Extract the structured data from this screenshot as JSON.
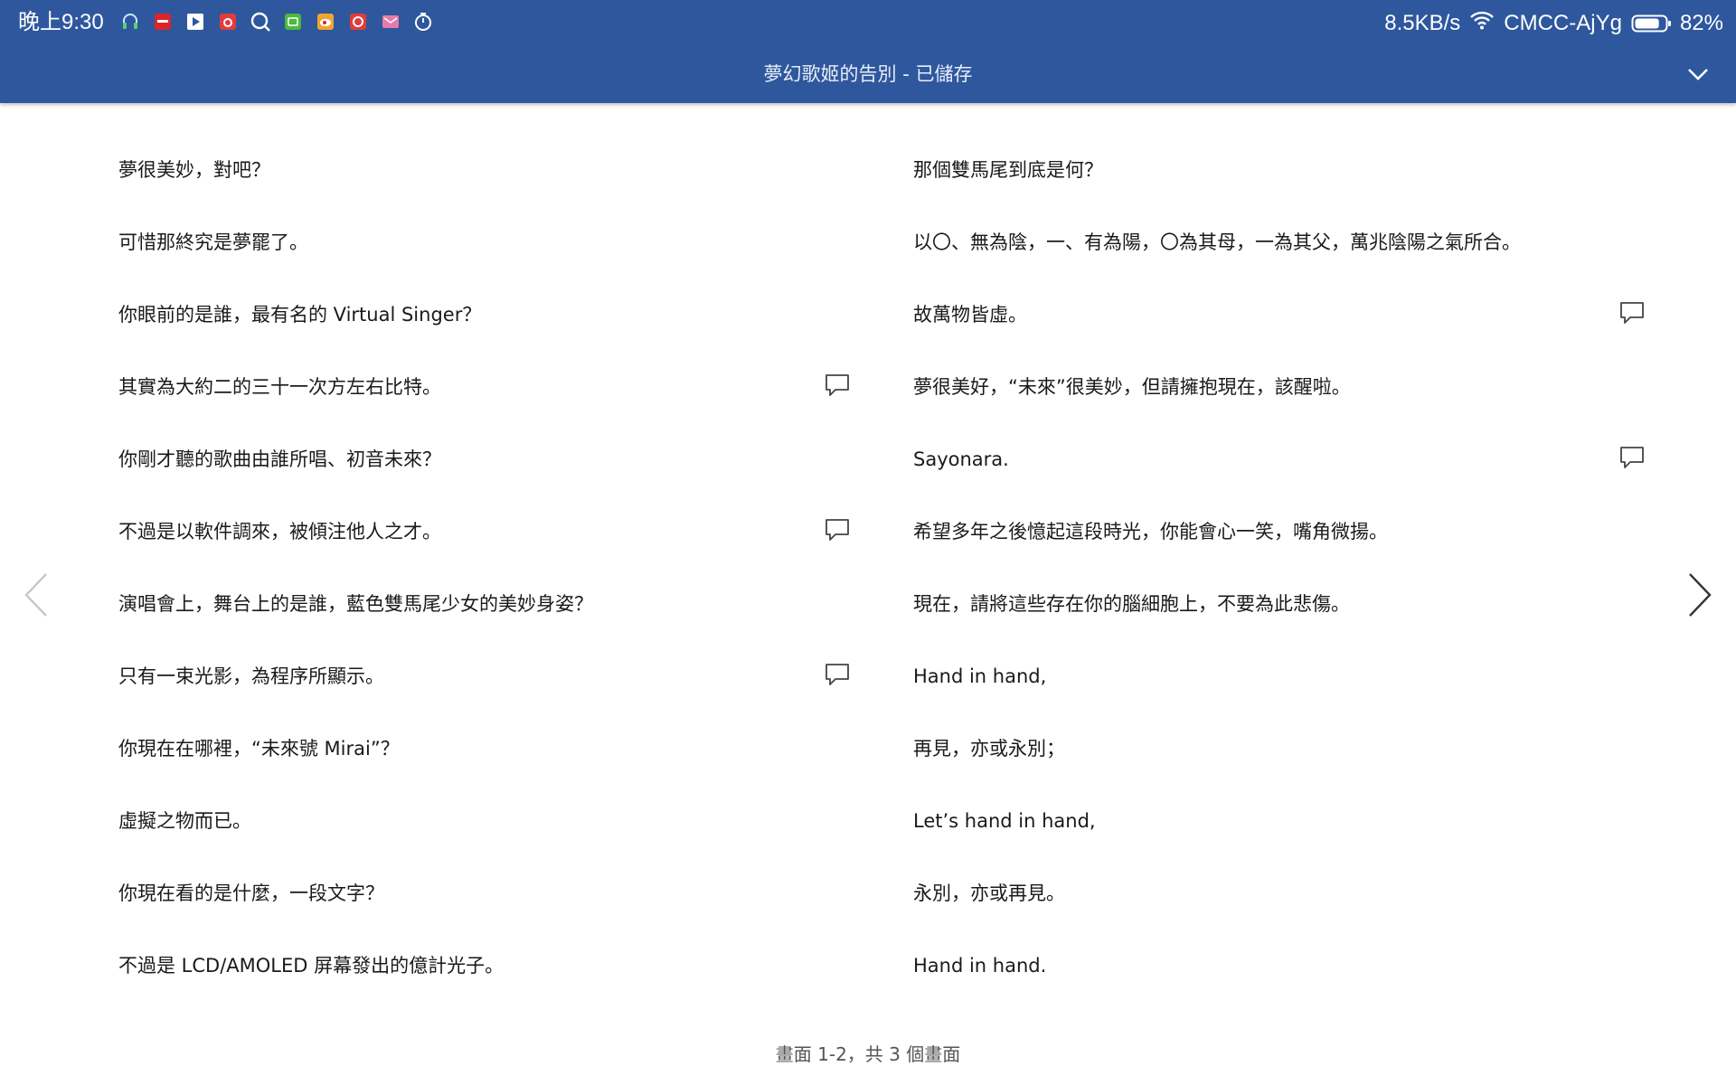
{
  "status_bar": {
    "time": "晚上9:30",
    "notification_icons": [
      "headset-icon",
      "news-app-icon",
      "video-play-icon",
      "bug-app-icon",
      "search-app-icon",
      "iqiyi-app-icon",
      "weibo-app-icon",
      "netease-music-icon",
      "mail-app-icon",
      "timer-icon"
    ],
    "network_speed": "8.5KB/s",
    "wifi_name": "CMCC-AjYg",
    "battery_percent": "82%",
    "battery_level": 0.82
  },
  "header": {
    "title": "夢幻歌姬的告別 - 已儲存",
    "accent_color": "#2e579d"
  },
  "document": {
    "left_column": [
      {
        "text": "夢很美妙，對吧？",
        "has_comment": false
      },
      {
        "text": "可惜那終究是夢罷了。",
        "has_comment": false
      },
      {
        "text": "你眼前的是誰，最有名的 Virtual Singer？",
        "has_comment": false
      },
      {
        "text": "其實為大約二的三十一次方左右比特。",
        "has_comment": true
      },
      {
        "text": "你剛才聽的歌曲由誰所唱、初音未來？",
        "has_comment": false
      },
      {
        "text": "不過是以軟件調來，被傾注他人之才。",
        "has_comment": true
      },
      {
        "text": "演唱會上，舞台上的是誰，藍色雙馬尾少女的美妙身姿？",
        "has_comment": false
      },
      {
        "text": "只有一束光影，為程序所顯示。",
        "has_comment": true
      },
      {
        "text": "你現在在哪裡，“未來號 Mirai”？",
        "has_comment": false
      },
      {
        "text": "虛擬之物而已。",
        "has_comment": false
      },
      {
        "text": "你現在看的是什麼，一段文字？",
        "has_comment": false
      },
      {
        "text": "不過是 LCD/AMOLED 屏幕發出的億計光子。",
        "has_comment": false
      }
    ],
    "right_column": [
      {
        "text": "那個雙馬尾到底是何？",
        "has_comment": false
      },
      {
        "text": "以〇、無為陰，一、有為陽，〇為其母，一為其父，萬兆陰陽之氣所合。",
        "has_comment": false
      },
      {
        "text": "故萬物皆虛。",
        "has_comment": true
      },
      {
        "text": "夢很美好，“未來”很美妙，但請擁抱現在，該醒啦。",
        "has_comment": false
      },
      {
        "text": "Sayonara.",
        "has_comment": true
      },
      {
        "text": "希望多年之後憶起這段時光，你能會心一笑，嘴角微揚。",
        "has_comment": false
      },
      {
        "text": "現在，請將這些存在你的腦細胞上，不要為此悲傷。",
        "has_comment": false
      },
      {
        "text": "Hand in hand,",
        "has_comment": false
      },
      {
        "text": "再見，亦或永別；",
        "has_comment": false
      },
      {
        "text": "Let’s hand in hand,",
        "has_comment": false
      },
      {
        "text": "永別，亦或再見。",
        "has_comment": false
      },
      {
        "text": "Hand in hand.",
        "has_comment": false
      }
    ]
  },
  "footer": {
    "page_indicator": "畫面 1-2，共 3 個畫面"
  }
}
